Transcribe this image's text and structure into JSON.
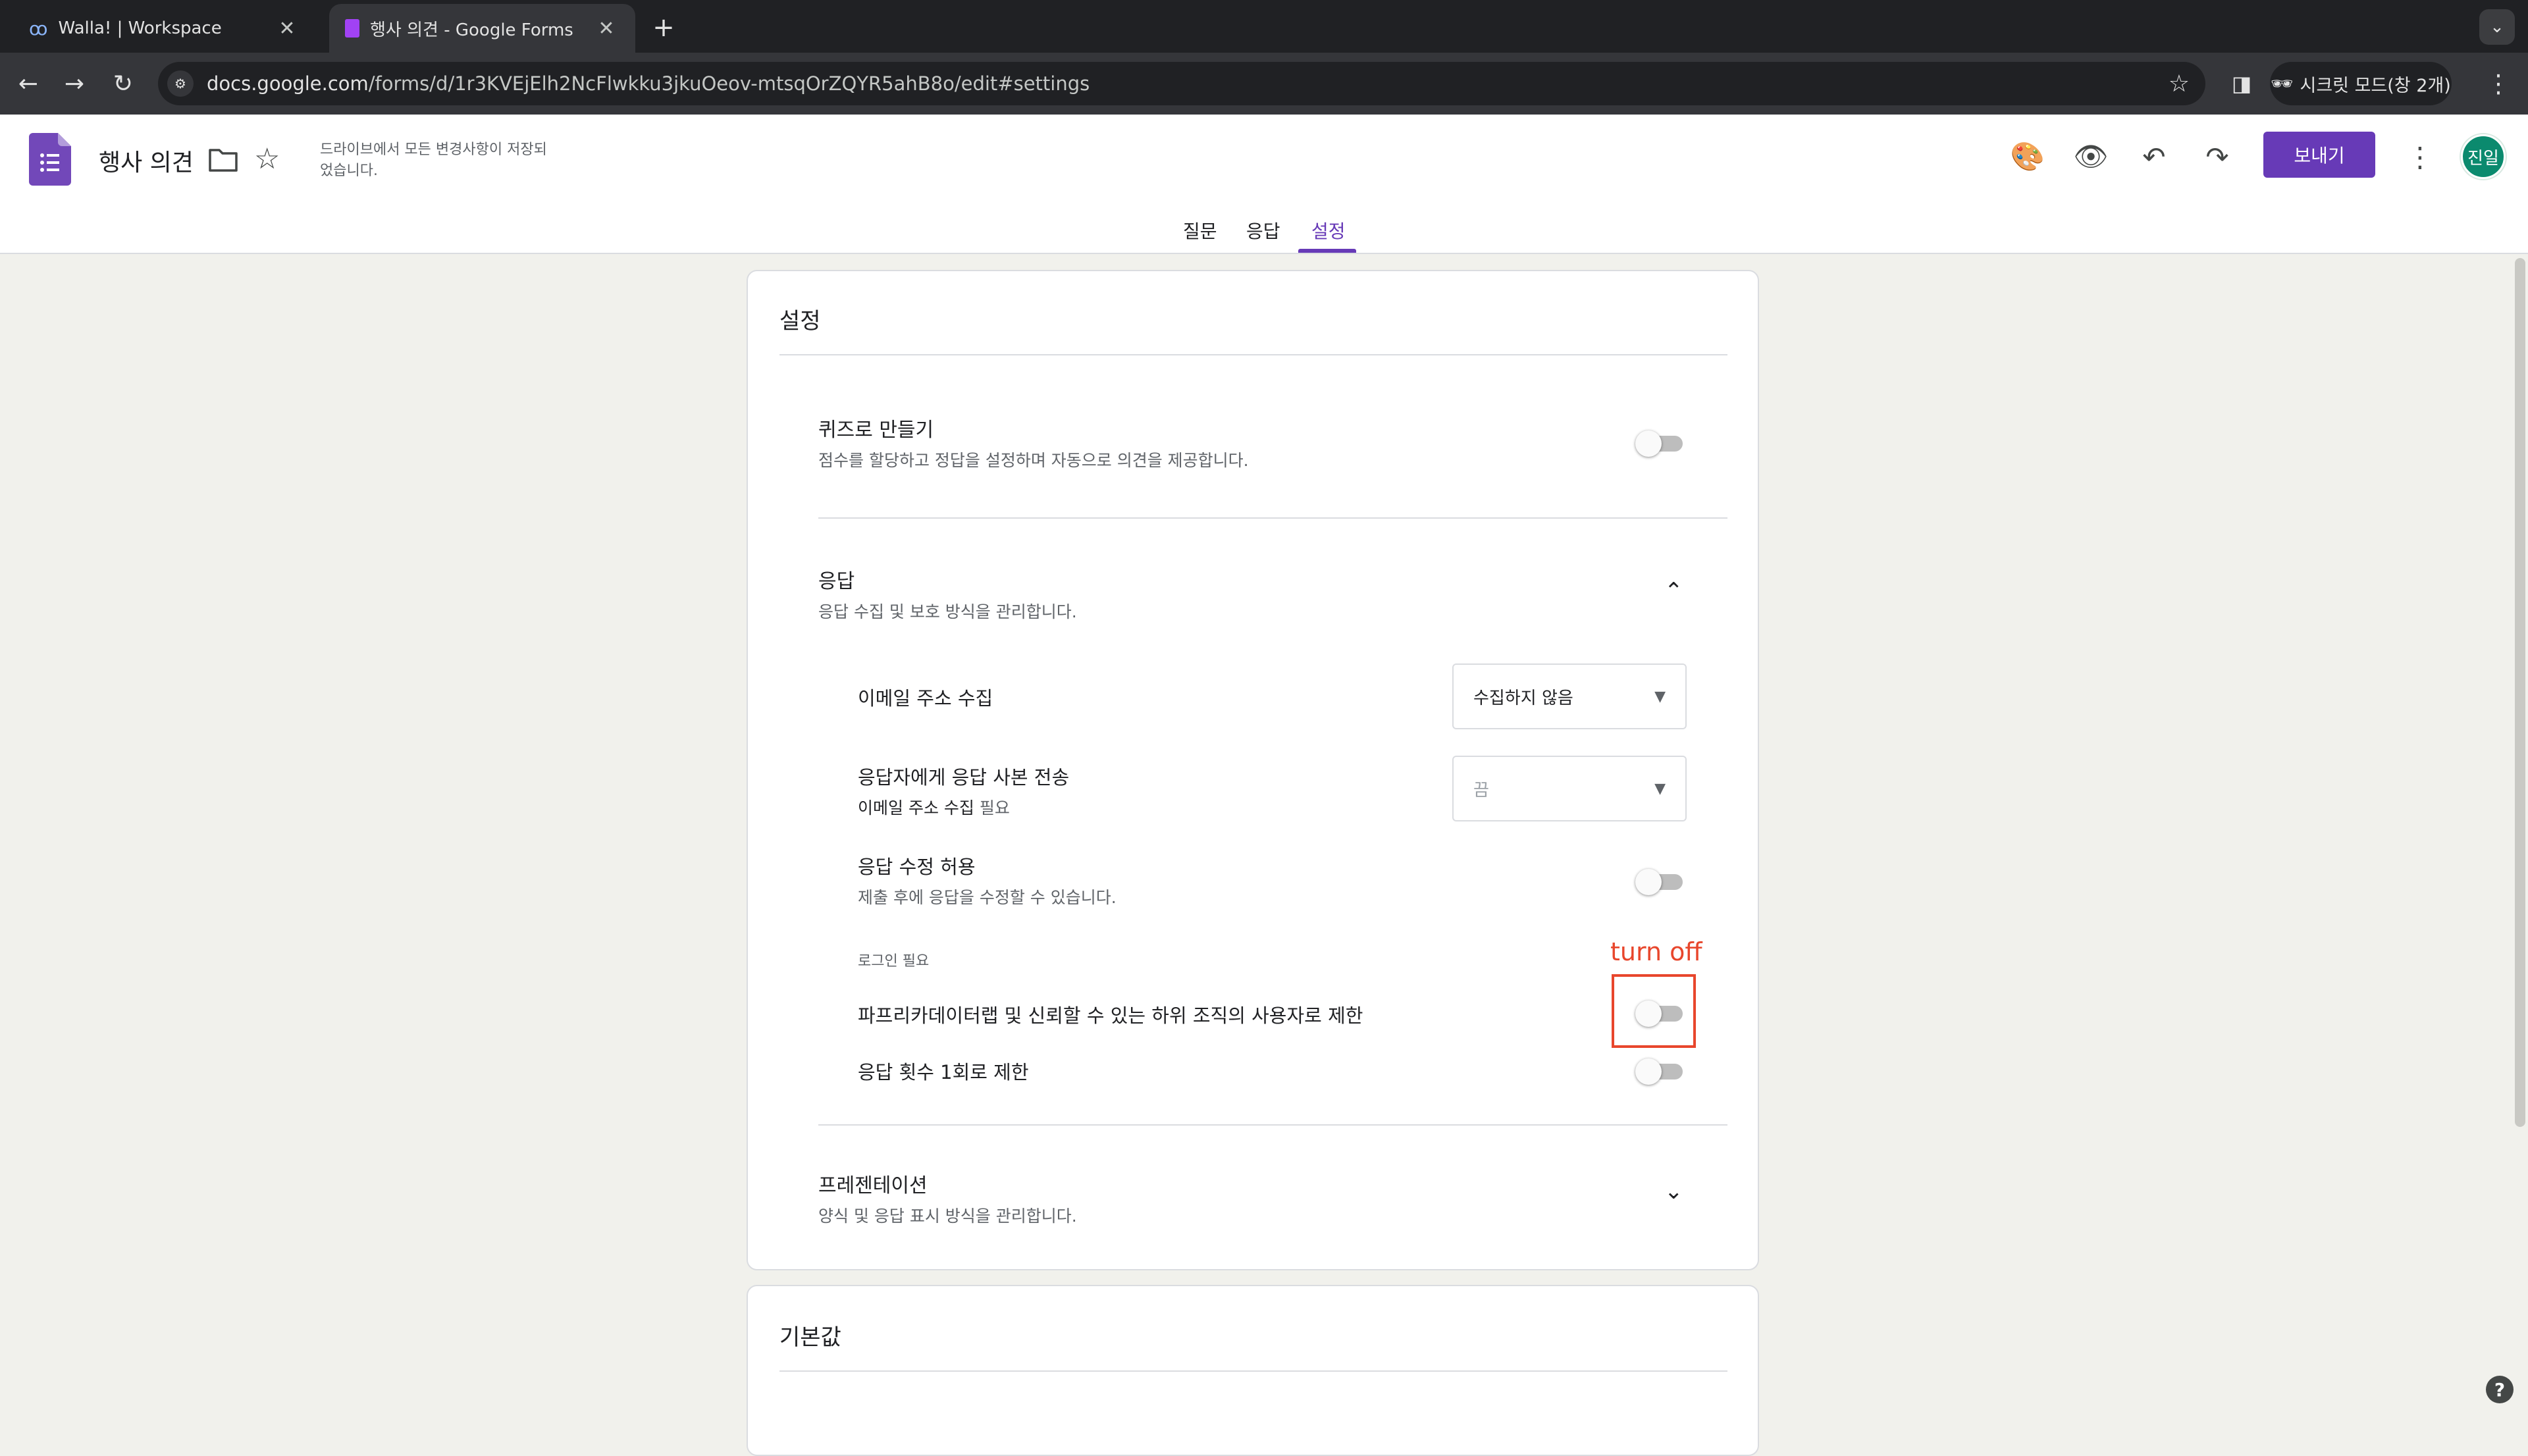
{
  "browser": {
    "tabs": [
      {
        "title": "Walla! | Workspace",
        "icon": "walla-logo-icon"
      },
      {
        "title": "행사 의견 - Google Forms",
        "icon": "forms-icon"
      }
    ],
    "url_host": "docs.google.com",
    "url_path": "/forms/d/1r3KVEjElh2NcFlwkku3jkuOeov-mtsqOrZQYR5ahB8o/edit#settings",
    "incognito_label": "시크릿 모드(창 2개)"
  },
  "header": {
    "doc_title": "행사 의견",
    "save_status": "드라이브에서 모든 변경사항이 저장되었습니다.",
    "send_label": "보내기",
    "avatar_initials": "진일",
    "accent_color": "#673ab7"
  },
  "form_tabs": {
    "questions": "질문",
    "responses": "응답",
    "settings": "설정",
    "active": "설정"
  },
  "settings": {
    "card_title": "설정",
    "quiz": {
      "title": "퀴즈로 만들기",
      "desc": "점수를 할당하고 정답을 설정하며 자동으로 의견을 제공합니다.",
      "enabled": false
    },
    "responses": {
      "title": "응답",
      "desc": "응답 수집 및 보호 방식을 관리합니다.",
      "expanded": true,
      "collect_email": {
        "label": "이메일 주소 수집",
        "value": "수집하지 않음"
      },
      "send_copy": {
        "label": "응답자에게 응답 사본 전송",
        "sub_bold": "이메일 주소 수집",
        "sub_rest": " 필요",
        "value": "끔"
      },
      "allow_edit": {
        "label": "응답 수정 허용",
        "desc": "제출 후에 응답을 수정할 수 있습니다.",
        "enabled": false
      },
      "login_required": "로그인 필요",
      "restrict_org": {
        "label": "파프리카데이터랩 및 신뢰할 수 있는 하위 조직의 사용자로 제한",
        "enabled": false
      },
      "limit_one": {
        "label": "응답 횟수 1회로 제한",
        "enabled": false
      }
    },
    "presentation": {
      "title": "프레젠테이션",
      "desc": "양식 및 응답 표시 방식을 관리합니다.",
      "expanded": false
    }
  },
  "defaults": {
    "card_title": "기본값"
  },
  "annotation": {
    "text": "turn off",
    "color": "#e8462c"
  }
}
